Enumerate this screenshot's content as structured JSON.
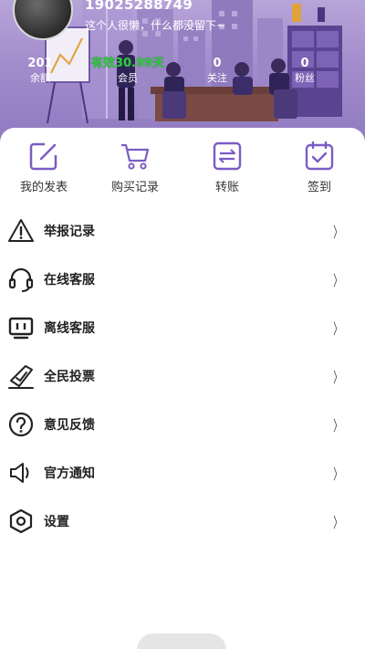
{
  "profile": {
    "username": "19025288749",
    "motto": "这个人很懒，什么都没留下~"
  },
  "stats": [
    {
      "value": "201",
      "label": "余额"
    },
    {
      "value": "有效30.99天",
      "label": "会员"
    },
    {
      "value": "0",
      "label": "关注"
    },
    {
      "value": "0",
      "label": "粉丝"
    }
  ],
  "quick_actions": [
    {
      "label": "我的发表",
      "icon": "edit-icon"
    },
    {
      "label": "购买记录",
      "icon": "cart-icon"
    },
    {
      "label": "转账",
      "icon": "transfer-icon"
    },
    {
      "label": "签到",
      "icon": "checkin-icon"
    }
  ],
  "menu": [
    {
      "label": "举报记录",
      "icon": "warning-icon",
      "chevron": "〉"
    },
    {
      "label": "在线客服",
      "icon": "headset-icon",
      "chevron": "〉"
    },
    {
      "label": "离线客服",
      "icon": "monitor-icon",
      "chevron": "〉"
    },
    {
      "label": "全民投票",
      "icon": "vote-icon",
      "chevron": "〉"
    },
    {
      "label": "意见反馈",
      "icon": "question-icon",
      "chevron": "〉"
    },
    {
      "label": "官方通知",
      "icon": "speaker-icon",
      "chevron": "〉"
    },
    {
      "label": "设置",
      "icon": "settings-icon",
      "chevron": "〉"
    }
  ],
  "colors": {
    "accent": "#7b5cc4",
    "vip_green": "#2ecc40",
    "header_purple": "#a38ccc"
  }
}
